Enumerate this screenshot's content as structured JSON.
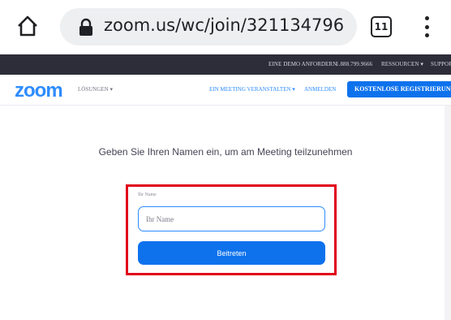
{
  "browser": {
    "url": "zoom.us/wc/join/321134796",
    "tab_count": "11",
    "icons": {
      "home": "home-icon",
      "lock": "lock-icon",
      "menu": "more-vert-icon"
    }
  },
  "topbar": {
    "request_demo": "EINE DEMO ANFORDERN",
    "phone": "1.888.799.9666",
    "resources": "RESSOURCEN ▾",
    "support": "SUPPORT"
  },
  "nav": {
    "logo": "zoom",
    "solutions": "LÖSUNGEN ▾",
    "host_meeting": "EIN MEETING VERANSTALTEN ▾",
    "sign_in": "ANMELDEN",
    "sign_up": "KOSTENLOSE REGISTRIERUNG"
  },
  "main": {
    "prompt": "Geben Sie Ihren Namen ein, um am Meeting teilzunehmen",
    "name_label": "Ihr Name",
    "name_placeholder": "Ihr Name",
    "name_value": "",
    "join_label": "Beitreten"
  },
  "colors": {
    "accent": "#2d8cff",
    "button": "#0e72ed",
    "topbar": "#2d2d3a",
    "highlight": "#e0001a"
  }
}
